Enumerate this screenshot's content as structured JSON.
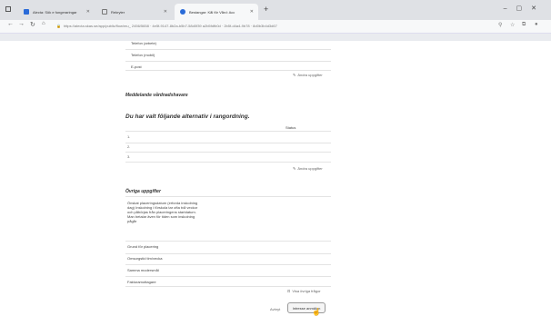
{
  "browser": {
    "tabs": [
      {
        "label": "Alecta: Sök e fungeraringar"
      },
      {
        "label": "Rekryter"
      },
      {
        "label": "Bestangar: Kål för Vård: Acc"
      }
    ],
    "url": "https://alecta.skas.se/app/public/flow/mu_ 2456/5658 · 4e5f-9147-8b2a-b5b7-58d0f39 a2b5fdfb0d · 2b5f-d4a4-9b78 · 8d0b3b4d3d67",
    "colors": {
      "chrome": "#dfe1e5",
      "accent": "#2a6bd8"
    }
  },
  "form": {
    "contact": {
      "phone_work_label": "Telefon (arbete)",
      "phone_mobile_label": "Telefon (mobil)",
      "email_label": "E-post",
      "edit_label": "Ändra uppgifter"
    },
    "employer_heading": "Meddelande vårdnadshavare",
    "choices": {
      "heading": "Du har valt följande alternativ i rangordning.",
      "status_col": "Status",
      "rows": [
        "1.",
        "2.",
        "3."
      ],
      "edit_label": "Ändra uppgifter"
    },
    "other": {
      "heading": "Övriga uppgifter",
      "paragraph": "Önskat placeringsdatum (erforda inskolning dag) Inskolning i förskola tar ofta två veckor och påbörjas från placeringens startdatum. Man betalar även för tiden som inskolning pågår",
      "reason_label": "Grund för placering",
      "hours_label": "Omsorgstid tim/vecka",
      "sibling_label": "Samma modersmål",
      "recipient_label": "Fakturamottagare",
      "other_info_label": "Visa övriga frågor"
    },
    "actions": {
      "cancel_label": "Avbryt",
      "submit_label": "Intresse anmälan"
    }
  }
}
